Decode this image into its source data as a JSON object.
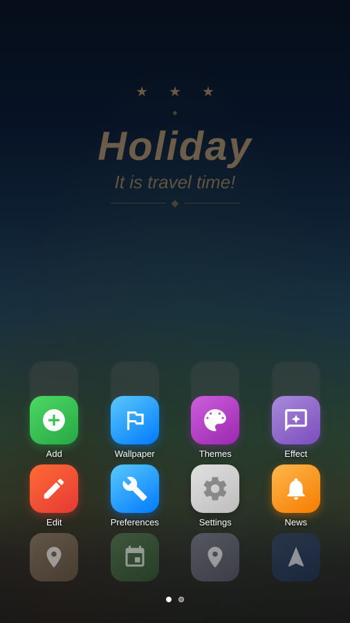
{
  "background": {
    "alt": "Holiday beach wallpaper"
  },
  "holiday": {
    "stars": [
      "★",
      "★",
      "★"
    ],
    "title": "Holiday",
    "subtitle": "It is travel time!",
    "dots": [
      "•",
      "•",
      "•"
    ]
  },
  "page_dots": [
    {
      "active": true
    },
    {
      "active": false
    }
  ],
  "app_rows": [
    {
      "apps": [
        {
          "id": "add",
          "label": "Add"
        },
        {
          "id": "wallpaper",
          "label": "Wallpaper"
        },
        {
          "id": "themes",
          "label": "Themes"
        },
        {
          "id": "effect",
          "label": "Effect"
        }
      ]
    },
    {
      "apps": [
        {
          "id": "edit",
          "label": "Edit"
        },
        {
          "id": "preferences",
          "label": "Preferences"
        },
        {
          "id": "settings",
          "label": "Settings"
        },
        {
          "id": "news",
          "label": "News"
        }
      ]
    }
  ]
}
